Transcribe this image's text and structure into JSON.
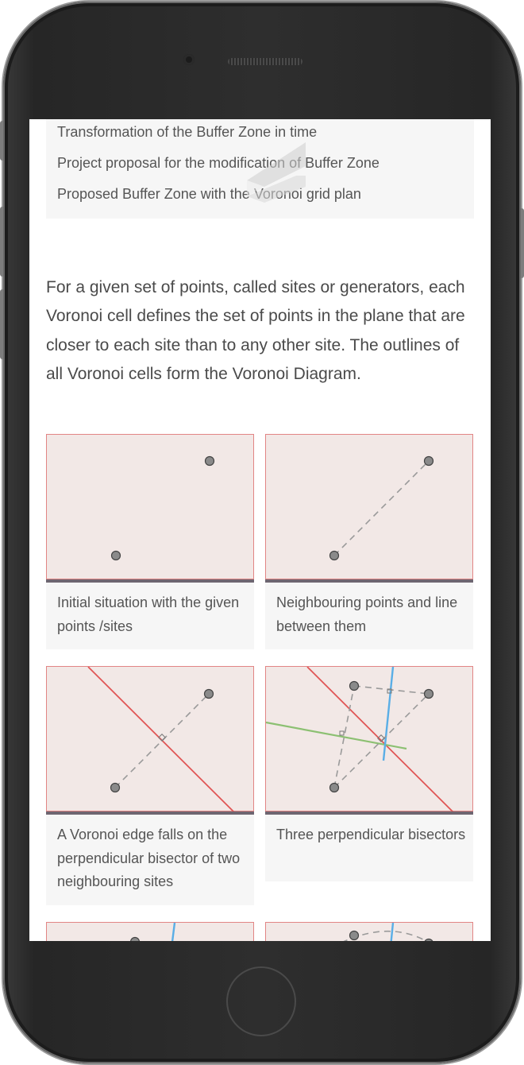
{
  "buffer_list": {
    "items": [
      "Transformation of the Buffer Zone in time",
      "Project proposal for the modification of Buffer Zone",
      "Proposed Buffer Zone with the Voronoi grid plan"
    ]
  },
  "intro_paragraph": "For a given set of points, called sites or generators, each Voronoi cell defines the set of points in the plane that are closer to each site than to any other site. The outlines of all Voronoi cells form the Voronoi Diagram.",
  "figures": [
    {
      "caption": "Initial situation with the given points /sites"
    },
    {
      "caption": "Neighbouring points and line between them"
    },
    {
      "caption": "A Voronoi edge falls on the perpendicular bisector of two neighbouring sites"
    },
    {
      "caption": "Three perpendicular bisectors"
    }
  ],
  "colors": {
    "panel_bg": "#f2e8e6",
    "panel_border": "#e28585",
    "bisector_red": "#e05555",
    "bisector_green": "#8cc072",
    "bisector_blue": "#5aaee6",
    "site_fill": "#8a8a8a",
    "caption_bg": "#f6f6f6"
  }
}
